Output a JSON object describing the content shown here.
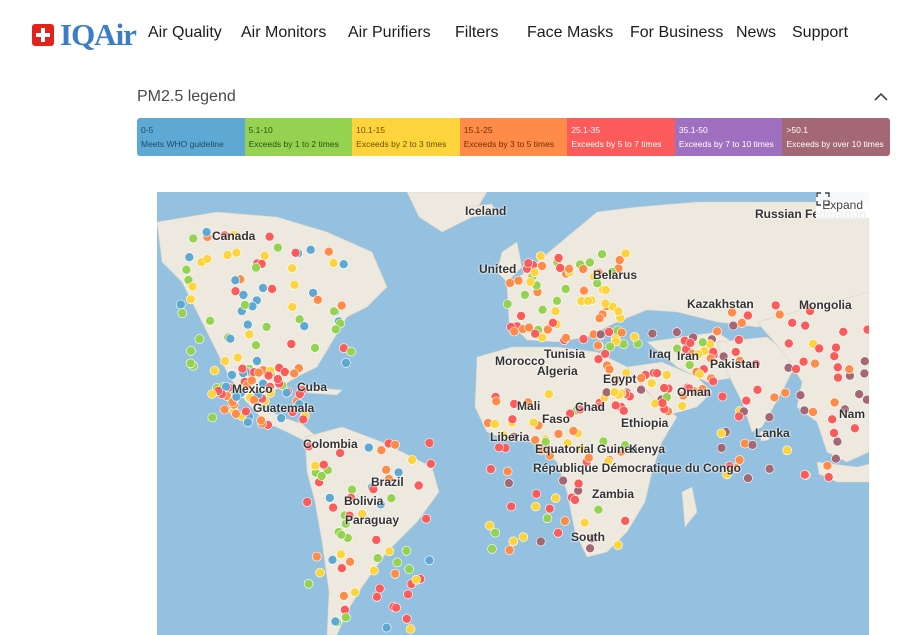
{
  "brand": {
    "name": "IQAir"
  },
  "nav": {
    "items": [
      {
        "label": "Air Quality"
      },
      {
        "label": "Air Monitors"
      },
      {
        "label": "Air Purifiers"
      },
      {
        "label": "Filters"
      },
      {
        "label": "Face Masks"
      },
      {
        "label": "For Business"
      },
      {
        "label": "News"
      },
      {
        "label": "Support"
      }
    ]
  },
  "legend": {
    "title": "PM2.5 legend",
    "segments": [
      {
        "range": "0-5",
        "desc": "Meets WHO guideline",
        "color": "#5ea9d3",
        "text_color": "#1f4a66"
      },
      {
        "range": "5.1-10",
        "desc": "Exceeds by 1 to 2 times",
        "color": "#95d24f",
        "text_color": "#2e5214"
      },
      {
        "range": "10.1-15",
        "desc": "Exceeds by 2 to 3 times",
        "color": "#fdd43b",
        "text_color": "#6b5200"
      },
      {
        "range": "15.1-25",
        "desc": "Exceeds by 3 to 5 times",
        "color": "#fe8c48",
        "text_color": "#6e2f00"
      },
      {
        "range": "25.1-35",
        "desc": "Exceeds by 5 to 7 times",
        "color": "#fb5b5b",
        "text_color": "#ffffff"
      },
      {
        "range": "35.1-50",
        "desc": "Exceeds by 7 to 10 times",
        "color": "#a070c0",
        "text_color": "#ffffff"
      },
      {
        "range": ">50.1",
        "desc": "Exceeds by over 10 times",
        "color": "#a36874",
        "text_color": "#ffffff"
      }
    ]
  },
  "map": {
    "expand_label": "Expand",
    "labels": [
      "Iceland",
      "Canada",
      "Russian Federation",
      "United",
      "Belarus",
      "Kazakhstan",
      "Mongolia",
      "Morocco",
      "Tunisia",
      "Iraq",
      "Iran",
      "Pakistan",
      "Algeria",
      "Egypt",
      "Oman",
      "Mexico",
      "Cuba",
      "Guatemala",
      "Mali",
      "Chad",
      "Faso",
      "Ethiopia",
      "Liberia",
      "Colombia",
      "Equatorial Guinea",
      "Kenya",
      "République Démocratique du Congo",
      "Lanka",
      "Brazil",
      "Bolivia",
      "Paraguay",
      "Zambia",
      "South",
      "Nam"
    ]
  },
  "colors": {
    "ocean": "#94c1e0",
    "land": "#ede9df",
    "brand_blue": "#3d7dc8",
    "brand_red": "#e2231a"
  }
}
